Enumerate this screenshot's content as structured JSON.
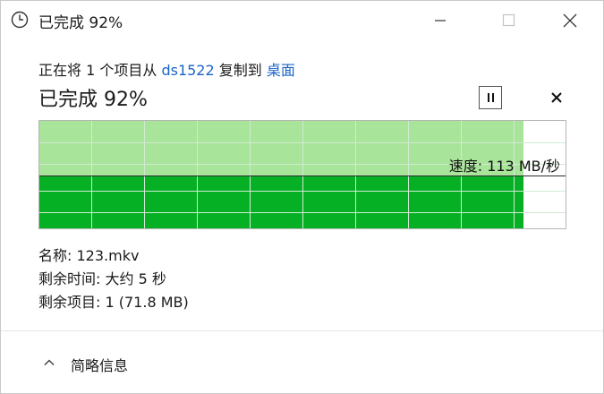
{
  "window": {
    "title": "已完成 92%"
  },
  "message": {
    "prefix": "正在将 1 个项目从 ",
    "source": "ds1522",
    "middle": " 复制到 ",
    "destination": "桌面"
  },
  "status": {
    "heading": "已完成 92%",
    "percent": 92
  },
  "graph": {
    "speed_label": "速度: 113 MB/秒"
  },
  "details": {
    "name_label": "名称: ",
    "name_value": "123.mkv",
    "time_label": "剩余时间: ",
    "time_value": "大约 5 秒",
    "items_label": "剩余项目: ",
    "items_value": "1 (71.8 MB)"
  },
  "footer": {
    "toggle_label": "简略信息"
  },
  "colors": {
    "progress_light": "#a8e49a",
    "progress_dark": "#06b025",
    "link": "#1a64c8"
  },
  "icons": {
    "app": "clock-icon",
    "minimize": "minimize-icon",
    "maximize": "maximize-icon",
    "close": "close-icon",
    "pause": "pause-icon",
    "cancel": "cancel-icon",
    "collapse": "chevron-up-icon"
  }
}
